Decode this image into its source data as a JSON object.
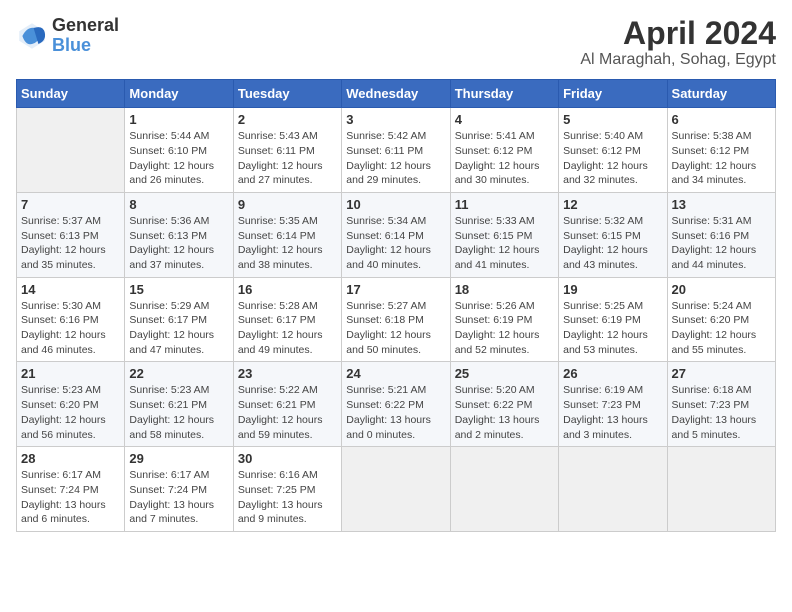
{
  "logo": {
    "line1": "General",
    "line2": "Blue"
  },
  "title": "April 2024",
  "location": "Al Maraghah, Sohag, Egypt",
  "days_header": [
    "Sunday",
    "Monday",
    "Tuesday",
    "Wednesday",
    "Thursday",
    "Friday",
    "Saturday"
  ],
  "weeks": [
    [
      {
        "num": "",
        "rise": "",
        "set": "",
        "daylight": "",
        "empty": true
      },
      {
        "num": "1",
        "rise": "Sunrise: 5:44 AM",
        "set": "Sunset: 6:10 PM",
        "daylight": "Daylight: 12 hours and 26 minutes."
      },
      {
        "num": "2",
        "rise": "Sunrise: 5:43 AM",
        "set": "Sunset: 6:11 PM",
        "daylight": "Daylight: 12 hours and 27 minutes."
      },
      {
        "num": "3",
        "rise": "Sunrise: 5:42 AM",
        "set": "Sunset: 6:11 PM",
        "daylight": "Daylight: 12 hours and 29 minutes."
      },
      {
        "num": "4",
        "rise": "Sunrise: 5:41 AM",
        "set": "Sunset: 6:12 PM",
        "daylight": "Daylight: 12 hours and 30 minutes."
      },
      {
        "num": "5",
        "rise": "Sunrise: 5:40 AM",
        "set": "Sunset: 6:12 PM",
        "daylight": "Daylight: 12 hours and 32 minutes."
      },
      {
        "num": "6",
        "rise": "Sunrise: 5:38 AM",
        "set": "Sunset: 6:12 PM",
        "daylight": "Daylight: 12 hours and 34 minutes."
      }
    ],
    [
      {
        "num": "7",
        "rise": "Sunrise: 5:37 AM",
        "set": "Sunset: 6:13 PM",
        "daylight": "Daylight: 12 hours and 35 minutes."
      },
      {
        "num": "8",
        "rise": "Sunrise: 5:36 AM",
        "set": "Sunset: 6:13 PM",
        "daylight": "Daylight: 12 hours and 37 minutes."
      },
      {
        "num": "9",
        "rise": "Sunrise: 5:35 AM",
        "set": "Sunset: 6:14 PM",
        "daylight": "Daylight: 12 hours and 38 minutes."
      },
      {
        "num": "10",
        "rise": "Sunrise: 5:34 AM",
        "set": "Sunset: 6:14 PM",
        "daylight": "Daylight: 12 hours and 40 minutes."
      },
      {
        "num": "11",
        "rise": "Sunrise: 5:33 AM",
        "set": "Sunset: 6:15 PM",
        "daylight": "Daylight: 12 hours and 41 minutes."
      },
      {
        "num": "12",
        "rise": "Sunrise: 5:32 AM",
        "set": "Sunset: 6:15 PM",
        "daylight": "Daylight: 12 hours and 43 minutes."
      },
      {
        "num": "13",
        "rise": "Sunrise: 5:31 AM",
        "set": "Sunset: 6:16 PM",
        "daylight": "Daylight: 12 hours and 44 minutes."
      }
    ],
    [
      {
        "num": "14",
        "rise": "Sunrise: 5:30 AM",
        "set": "Sunset: 6:16 PM",
        "daylight": "Daylight: 12 hours and 46 minutes."
      },
      {
        "num": "15",
        "rise": "Sunrise: 5:29 AM",
        "set": "Sunset: 6:17 PM",
        "daylight": "Daylight: 12 hours and 47 minutes."
      },
      {
        "num": "16",
        "rise": "Sunrise: 5:28 AM",
        "set": "Sunset: 6:17 PM",
        "daylight": "Daylight: 12 hours and 49 minutes."
      },
      {
        "num": "17",
        "rise": "Sunrise: 5:27 AM",
        "set": "Sunset: 6:18 PM",
        "daylight": "Daylight: 12 hours and 50 minutes."
      },
      {
        "num": "18",
        "rise": "Sunrise: 5:26 AM",
        "set": "Sunset: 6:19 PM",
        "daylight": "Daylight: 12 hours and 52 minutes."
      },
      {
        "num": "19",
        "rise": "Sunrise: 5:25 AM",
        "set": "Sunset: 6:19 PM",
        "daylight": "Daylight: 12 hours and 53 minutes."
      },
      {
        "num": "20",
        "rise": "Sunrise: 5:24 AM",
        "set": "Sunset: 6:20 PM",
        "daylight": "Daylight: 12 hours and 55 minutes."
      }
    ],
    [
      {
        "num": "21",
        "rise": "Sunrise: 5:23 AM",
        "set": "Sunset: 6:20 PM",
        "daylight": "Daylight: 12 hours and 56 minutes."
      },
      {
        "num": "22",
        "rise": "Sunrise: 5:23 AM",
        "set": "Sunset: 6:21 PM",
        "daylight": "Daylight: 12 hours and 58 minutes."
      },
      {
        "num": "23",
        "rise": "Sunrise: 5:22 AM",
        "set": "Sunset: 6:21 PM",
        "daylight": "Daylight: 12 hours and 59 minutes."
      },
      {
        "num": "24",
        "rise": "Sunrise: 5:21 AM",
        "set": "Sunset: 6:22 PM",
        "daylight": "Daylight: 13 hours and 0 minutes."
      },
      {
        "num": "25",
        "rise": "Sunrise: 5:20 AM",
        "set": "Sunset: 6:22 PM",
        "daylight": "Daylight: 13 hours and 2 minutes."
      },
      {
        "num": "26",
        "rise": "Sunrise: 6:19 AM",
        "set": "Sunset: 7:23 PM",
        "daylight": "Daylight: 13 hours and 3 minutes."
      },
      {
        "num": "27",
        "rise": "Sunrise: 6:18 AM",
        "set": "Sunset: 7:23 PM",
        "daylight": "Daylight: 13 hours and 5 minutes."
      }
    ],
    [
      {
        "num": "28",
        "rise": "Sunrise: 6:17 AM",
        "set": "Sunset: 7:24 PM",
        "daylight": "Daylight: 13 hours and 6 minutes."
      },
      {
        "num": "29",
        "rise": "Sunrise: 6:17 AM",
        "set": "Sunset: 7:24 PM",
        "daylight": "Daylight: 13 hours and 7 minutes."
      },
      {
        "num": "30",
        "rise": "Sunrise: 6:16 AM",
        "set": "Sunset: 7:25 PM",
        "daylight": "Daylight: 13 hours and 9 minutes."
      },
      {
        "num": "",
        "rise": "",
        "set": "",
        "daylight": "",
        "empty": true
      },
      {
        "num": "",
        "rise": "",
        "set": "",
        "daylight": "",
        "empty": true
      },
      {
        "num": "",
        "rise": "",
        "set": "",
        "daylight": "",
        "empty": true
      },
      {
        "num": "",
        "rise": "",
        "set": "",
        "daylight": "",
        "empty": true
      }
    ]
  ]
}
